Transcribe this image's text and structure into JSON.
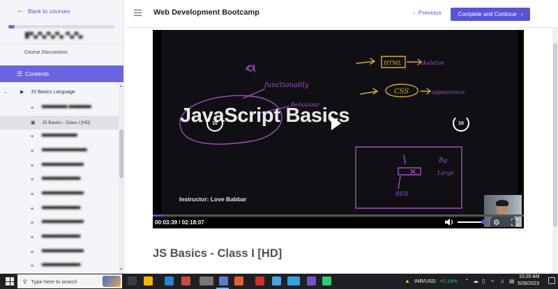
{
  "sidebar": {
    "back_label": "Back to courses",
    "progress_pct": 6,
    "course_subtitle": "█▀▄▀▄▀▄▀▄ ▀▄▀▄",
    "discussions_label": "Course Discussions",
    "contents_label": "Contents",
    "section_label": "JS Basics Language",
    "lessons": [
      {
        "label": "▀▀▀▀▀▀▀▀ ▀▀▀▀▀▀▀",
        "active": false,
        "icon": "document-icon"
      },
      {
        "label": "JS Basics - Class I [HD]",
        "active": true,
        "icon": "video-icon"
      },
      {
        "label": "▀▀▀▀▀▀▀▀▀▀▀",
        "active": false,
        "icon": "document-icon"
      },
      {
        "label": "▀▀▀▀▀▀▀▀▀▀▀▀▀▀",
        "active": false,
        "icon": "document-icon"
      },
      {
        "label": "▀▀▀▀▀▀▀▀▀▀▀▀▀",
        "active": false,
        "icon": "document-icon"
      },
      {
        "label": "▀▀▀▀▀▀▀▀▀▀▀▀",
        "active": false,
        "icon": "document-icon"
      },
      {
        "label": "▀▀▀▀▀▀▀▀▀▀▀▀▀",
        "active": false,
        "icon": "document-icon"
      },
      {
        "label": "▀▀▀▀▀▀▀▀▀▀▀▀",
        "active": false,
        "icon": "document-icon"
      },
      {
        "label": "▀▀▀▀▀▀▀▀▀▀▀▀▀",
        "active": false,
        "icon": "document-icon"
      },
      {
        "label": "▀▀▀▀▀▀▀▀▀▀▀▀",
        "active": false,
        "icon": "document-icon"
      },
      {
        "label": "▀▀▀▀▀▀▀▀▀▀▀▀▀",
        "active": false,
        "icon": "document-icon"
      },
      {
        "label": "▀▀▀▀▀▀▀▀▀▀▀▀",
        "active": false,
        "icon": "document-icon"
      }
    ]
  },
  "header": {
    "course_title": "Web Development Bootcamp",
    "previous_label": "Previous",
    "complete_label": "Complete and Continue"
  },
  "player": {
    "heading": "JavaScript Basics",
    "instructor": "Instructor: Love Babbar",
    "current_time": "00:03:39",
    "duration": "/ 02:18:07",
    "progress_fraction": 0.026,
    "volume_fraction": 0.9,
    "skip_label": "10",
    "board_notes": [
      "a",
      "functionality",
      "Behaviour",
      "HTML",
      "skeleton",
      "CSS",
      "appearance",
      "Bg",
      "Large",
      "RED"
    ],
    "colors": {
      "ink_purple": "#a04fc4",
      "ink_yellow": "#d8a93a",
      "accent": "#5b53d6"
    }
  },
  "lesson_title": "JS Basics - Class I [HD]",
  "taskbar": {
    "search_placeholder": "Type here to search",
    "ticker_label": "INR/USD",
    "ticker_change": "+0.19%",
    "time": "10:20 AM",
    "date": "5/26/2023"
  }
}
